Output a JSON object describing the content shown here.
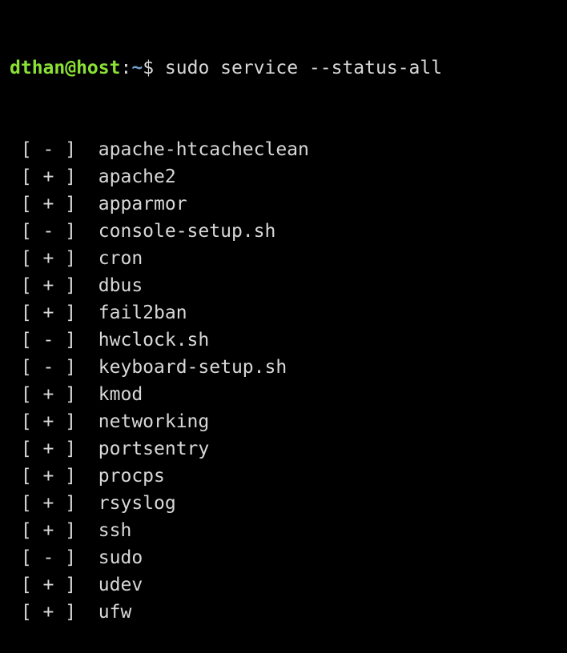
{
  "prompt": {
    "user_host": "dthan@host",
    "colon": ":",
    "path": "~",
    "dollar": "$",
    "command": " sudo service --status-all"
  },
  "colors": {
    "background": "#000000",
    "text": "#d8d8d8",
    "user_host": "#8ae234",
    "path": "#729fcf"
  },
  "services": [
    {
      "status": " [ - ]  ",
      "name": "apache-htcacheclean"
    },
    {
      "status": " [ + ]  ",
      "name": "apache2"
    },
    {
      "status": " [ + ]  ",
      "name": "apparmor"
    },
    {
      "status": " [ - ]  ",
      "name": "console-setup.sh"
    },
    {
      "status": " [ + ]  ",
      "name": "cron"
    },
    {
      "status": " [ + ]  ",
      "name": "dbus"
    },
    {
      "status": " [ + ]  ",
      "name": "fail2ban"
    },
    {
      "status": " [ - ]  ",
      "name": "hwclock.sh"
    },
    {
      "status": " [ - ]  ",
      "name": "keyboard-setup.sh"
    },
    {
      "status": " [ + ]  ",
      "name": "kmod"
    },
    {
      "status": " [ + ]  ",
      "name": "networking"
    },
    {
      "status": " [ + ]  ",
      "name": "portsentry"
    },
    {
      "status": " [ + ]  ",
      "name": "procps"
    },
    {
      "status": " [ + ]  ",
      "name": "rsyslog"
    },
    {
      "status": " [ + ]  ",
      "name": "ssh"
    },
    {
      "status": " [ - ]  ",
      "name": "sudo"
    },
    {
      "status": " [ + ]  ",
      "name": "udev"
    },
    {
      "status": " [ + ]  ",
      "name": "ufw"
    }
  ]
}
